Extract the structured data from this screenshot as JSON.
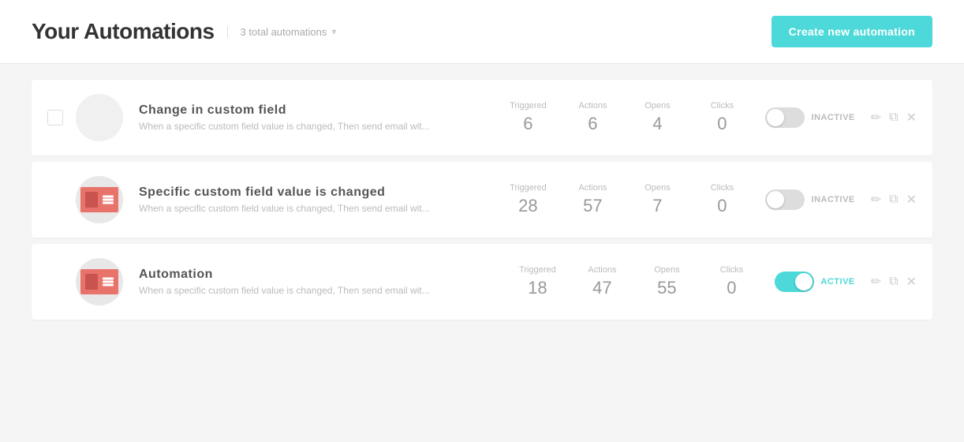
{
  "header": {
    "title": "Your Automations",
    "total_label": "3 total automations",
    "create_button_label": "Create new automation"
  },
  "automations": [
    {
      "id": "automation-1",
      "name": "Change in custom field",
      "description": "When a specific custom field value is changed, Then send email wit...",
      "has_icon": false,
      "stats": {
        "triggered_label": "Triggered",
        "triggered_value": "6",
        "actions_label": "Actions",
        "actions_value": "6",
        "opens_label": "Opens",
        "opens_value": "4",
        "clicks_label": "Clicks",
        "clicks_value": "0"
      },
      "status": "inactive",
      "status_label": "INACTIVE"
    },
    {
      "id": "automation-2",
      "name": "Specific custom field value is changed",
      "description": "When a specific custom field value is changed, Then send email wit...",
      "has_icon": true,
      "stats": {
        "triggered_label": "Triggered",
        "triggered_value": "28",
        "actions_label": "Actions",
        "actions_value": "57",
        "opens_label": "Opens",
        "opens_value": "7",
        "clicks_label": "Clicks",
        "clicks_value": "0"
      },
      "status": "inactive",
      "status_label": "INACTIVE"
    },
    {
      "id": "automation-3",
      "name": "Automation",
      "description": "When a specific custom field value is changed, Then send email wit...",
      "has_icon": true,
      "stats": {
        "triggered_label": "Triggered",
        "triggered_value": "18",
        "actions_label": "Actions",
        "actions_value": "47",
        "opens_label": "Opens",
        "opens_value": "55",
        "clicks_label": "Clicks",
        "clicks_value": "0"
      },
      "status": "active",
      "status_label": "ACTIVE"
    }
  ],
  "icons": {
    "filter": "▾",
    "edit": "✏",
    "copy": "⧉",
    "delete": "✕"
  }
}
